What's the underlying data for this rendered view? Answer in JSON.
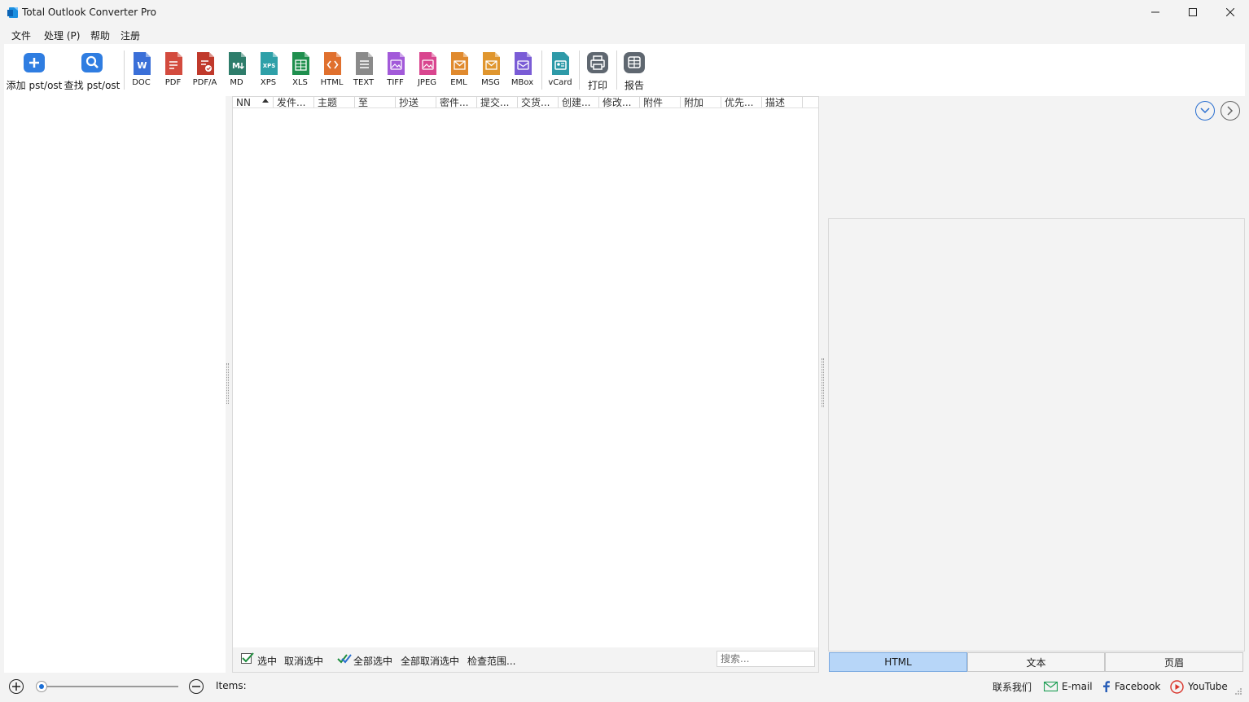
{
  "window": {
    "title": "Total Outlook Converter Pro"
  },
  "menu": [
    {
      "label": "文件"
    },
    {
      "label": "处理 (P)"
    },
    {
      "label": "帮助"
    },
    {
      "label": "注册"
    }
  ],
  "toolbar": {
    "add": "添加 pst/ost",
    "find": "查找 pst/ost",
    "formats": [
      "DOC",
      "PDF",
      "PDF/A",
      "MD",
      "XPS",
      "XLS",
      "HTML",
      "TEXT",
      "TIFF",
      "JPEG",
      "EML",
      "MSG",
      "MBox"
    ],
    "vcard": "vCard",
    "print": "打印",
    "report": "报告"
  },
  "columns": [
    "NN",
    "发件...",
    "主题",
    "至",
    "抄送",
    "密件...",
    "提交...",
    "交货...",
    "创建...",
    "修改...",
    "附件",
    "附加",
    "优先...",
    "描述"
  ],
  "bottom_bar": {
    "check": "选中",
    "uncheck": "取消选中",
    "check_all": "全部选中",
    "uncheck_all": "全部取消选中",
    "check_range": "检查范围...",
    "search_placeholder": "搜索..."
  },
  "view_tabs": [
    "HTML",
    "文本",
    "页眉"
  ],
  "status": {
    "items_label": "Items:",
    "contact": "联系我们",
    "email": "E-mail",
    "facebook": "Facebook",
    "youtube": "YouTube",
    "zoom_level_fraction": 0.03
  },
  "colors": {
    "doc": "#3a6fd8",
    "pdf": "#d34b3e",
    "pdfa": "#c0392b",
    "md": "#2e7d6b",
    "xps": "#2ea0a8",
    "xls": "#1f8f4e",
    "html": "#e0702e",
    "text": "#8a8a8a",
    "tiff": "#a259d9",
    "jpeg": "#d9468f",
    "eml": "#e08a2e",
    "msg": "#e0962e",
    "mbox": "#7a5cd6",
    "vcard": "#2e9aa8",
    "accent": "#1b6fd6",
    "active_tab": "#b7d6f8"
  }
}
